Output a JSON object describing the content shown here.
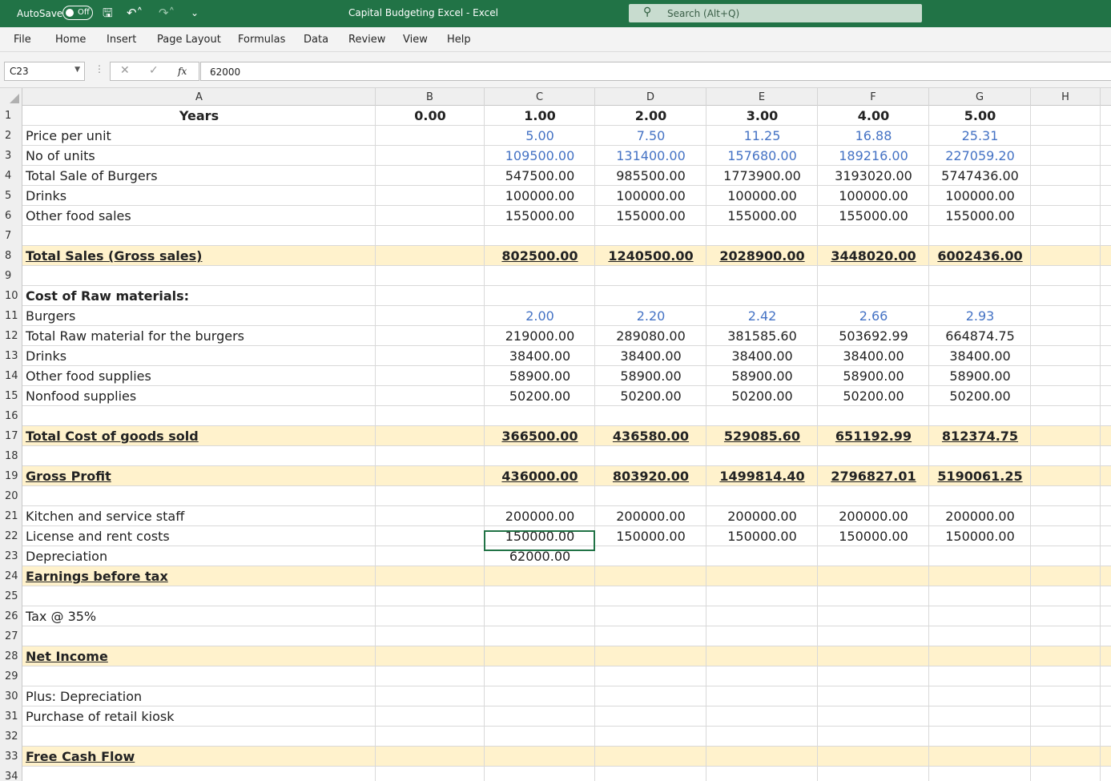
{
  "titlebar": {
    "autosave_label": "AutoSave",
    "autosave_state": "Off",
    "title": "Capital Budgeting Excel  -  Excel",
    "search_placeholder": "Search (Alt+Q)",
    "icons": [
      "save-icon",
      "undo-icon",
      "redo-icon",
      "customize-icon"
    ]
  },
  "menu": [
    "File",
    "Home",
    "Insert",
    "Page Layout",
    "Formulas",
    "Data",
    "Review",
    "View",
    "Help"
  ],
  "formula_bar": {
    "name_box": "C23",
    "formula": "62000",
    "fx": "fx"
  },
  "columns": [
    "A",
    "B",
    "C",
    "D",
    "E",
    "F",
    "G",
    "H"
  ],
  "colors": {
    "brand": "#217346",
    "highlight": "#fff2cc",
    "input_blue": "#4472c4"
  },
  "rows": [
    {
      "n": "1",
      "label": "Years",
      "style": "years",
      "b": "0.00",
      "values": [
        "1.00",
        "2.00",
        "3.00",
        "4.00",
        "5.00"
      ],
      "vstyle": "bold"
    },
    {
      "n": "2",
      "label": "Price per unit",
      "values": [
        "5.00",
        "7.50",
        "11.25",
        "16.88",
        "25.31"
      ],
      "vstyle": "blue"
    },
    {
      "n": "3",
      "label": "No of units",
      "values": [
        "109500.00",
        "131400.00",
        "157680.00",
        "189216.00",
        "227059.20"
      ],
      "vstyle": "blue"
    },
    {
      "n": "4",
      "label": "Total Sale of Burgers",
      "values": [
        "547500.00",
        "985500.00",
        "1773900.00",
        "3193020.00",
        "5747436.00"
      ]
    },
    {
      "n": "5",
      "label": "Drinks",
      "values": [
        "100000.00",
        "100000.00",
        "100000.00",
        "100000.00",
        "100000.00"
      ]
    },
    {
      "n": "6",
      "label": "Other food sales",
      "values": [
        "155000.00",
        "155000.00",
        "155000.00",
        "155000.00",
        "155000.00"
      ]
    },
    {
      "n": "7",
      "label": ""
    },
    {
      "n": "8",
      "label": "Total Sales (Gross sales)",
      "style": "u",
      "hl": true,
      "values": [
        "802500.00",
        "1240500.00",
        "2028900.00",
        "3448020.00",
        "6002436.00"
      ],
      "vstyle": "u"
    },
    {
      "n": "9",
      "label": ""
    },
    {
      "n": "10",
      "label": "Cost of Raw materials:",
      "style": "b"
    },
    {
      "n": "11",
      "label": "Burgers",
      "values": [
        "2.00",
        "2.20",
        "2.42",
        "2.66",
        "2.93"
      ],
      "vstyle": "blue"
    },
    {
      "n": "12",
      "label": "Total Raw material for the burgers",
      "values": [
        "219000.00",
        "289080.00",
        "381585.60",
        "503692.99",
        "664874.75"
      ]
    },
    {
      "n": "13",
      "label": "Drinks",
      "values": [
        "38400.00",
        "38400.00",
        "38400.00",
        "38400.00",
        "38400.00"
      ]
    },
    {
      "n": "14",
      "label": "Other food supplies",
      "values": [
        "58900.00",
        "58900.00",
        "58900.00",
        "58900.00",
        "58900.00"
      ]
    },
    {
      "n": "15",
      "label": "Nonfood supplies",
      "values": [
        "50200.00",
        "50200.00",
        "50200.00",
        "50200.00",
        "50200.00"
      ]
    },
    {
      "n": "16",
      "label": ""
    },
    {
      "n": "17",
      "label": "Total Cost of goods sold",
      "style": "u",
      "hl": true,
      "values": [
        "366500.00",
        "436580.00",
        "529085.60",
        "651192.99",
        "812374.75"
      ],
      "vstyle": "u"
    },
    {
      "n": "18",
      "label": ""
    },
    {
      "n": "19",
      "label": "Gross Profit",
      "style": "u",
      "hl": true,
      "values": [
        "436000.00",
        "803920.00",
        "1499814.40",
        "2796827.01",
        "5190061.25"
      ],
      "vstyle": "u"
    },
    {
      "n": "20",
      "label": ""
    },
    {
      "n": "21",
      "label": "Kitchen and service staff",
      "values": [
        "200000.00",
        "200000.00",
        "200000.00",
        "200000.00",
        "200000.00"
      ]
    },
    {
      "n": "22",
      "label": "License and rent costs",
      "values": [
        "150000.00",
        "150000.00",
        "150000.00",
        "150000.00",
        "150000.00"
      ]
    },
    {
      "n": "23",
      "label": "Depreciation",
      "values": [
        "62000.00"
      ]
    },
    {
      "n": "24",
      "label": "Earnings before tax",
      "style": "u",
      "hl": true
    },
    {
      "n": "25",
      "label": ""
    },
    {
      "n": "26",
      "label": "Tax @ 35%"
    },
    {
      "n": "27",
      "label": ""
    },
    {
      "n": "28",
      "label": "Net Income",
      "style": "u",
      "hl": true
    },
    {
      "n": "29",
      "label": ""
    },
    {
      "n": "30",
      "label": "Plus: Depreciation"
    },
    {
      "n": "31",
      "label": "Purchase of retail kiosk"
    },
    {
      "n": "32",
      "label": ""
    },
    {
      "n": "33",
      "label": "Free Cash Flow",
      "style": "u",
      "hl": true
    },
    {
      "n": "34",
      "label": ""
    }
  ]
}
